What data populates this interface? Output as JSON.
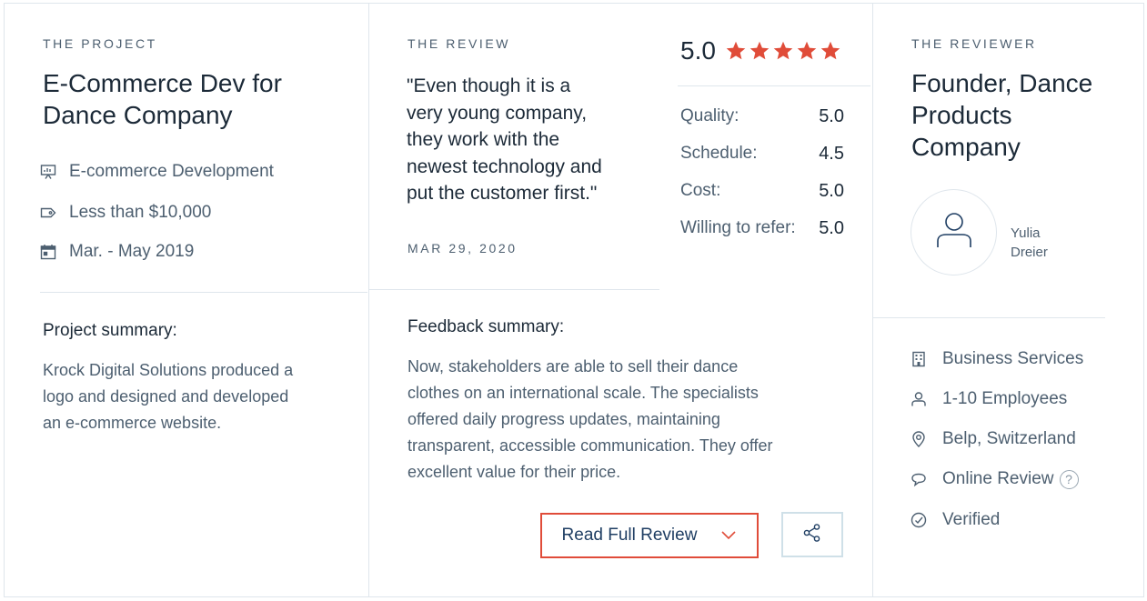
{
  "project": {
    "eyebrow": "THE PROJECT",
    "title_line1": "E-Commerce Dev for",
    "title_line2": "Dance Company",
    "meta": [
      {
        "icon": "presentation-chart-icon",
        "text": "E-commerce Development"
      },
      {
        "icon": "price-tag-icon",
        "text": "Less than $10,000"
      },
      {
        "icon": "calendar-icon",
        "text": "Mar. - May 2019"
      }
    ],
    "summary_heading": "Project summary:",
    "summary_lines": [
      "Krock Digital Solutions produced a",
      "logo and designed and developed",
      "an e-commerce website."
    ]
  },
  "review": {
    "eyebrow": "THE REVIEW",
    "quote_lines": [
      "\"Even though it is a",
      "very young company,",
      "they work with the",
      "newest technology and",
      "put the customer first.\""
    ],
    "date": "MAR 29, 2020",
    "overall": "5.0",
    "stars": 5,
    "star_color": "#e04c39",
    "ratings": [
      {
        "label": "Quality:",
        "value": "5.0"
      },
      {
        "label": "Schedule:",
        "value": "4.5"
      },
      {
        "label": "Cost:",
        "value": "5.0"
      },
      {
        "label": "Willing to refer:",
        "value": "5.0"
      }
    ],
    "feedback_heading": "Feedback summary:",
    "feedback_lines": [
      "Now, stakeholders are able to sell their dance",
      "clothes on an international scale. The specialists",
      "offered daily progress updates, maintaining",
      "transparent, accessible communication. They offer",
      "excellent value for their price."
    ],
    "read_full_label": "Read Full Review",
    "share_icon": "share-icon"
  },
  "reviewer": {
    "eyebrow": "THE REVIEWER",
    "title_lines": [
      "Founder, Dance",
      "Products",
      "Company"
    ],
    "name_line1": "Yulia",
    "name_line2": "Dreier",
    "info": [
      {
        "icon": "building-icon",
        "text": "Business Services"
      },
      {
        "icon": "person-icon",
        "text": "1-10 Employees"
      },
      {
        "icon": "location-pin-icon",
        "text": "Belp, Switzerland"
      },
      {
        "icon": "chat-bubble-icon",
        "text": "Online Review"
      },
      {
        "icon": "check-circle-icon",
        "text": "Verified"
      }
    ],
    "help_mark": "?"
  },
  "colors": {
    "accent": "#e04c39",
    "text_dark": "#1c2a38",
    "text_muted": "#4d5f70",
    "border": "#dfe6ec",
    "button_text": "#1f3e63"
  }
}
